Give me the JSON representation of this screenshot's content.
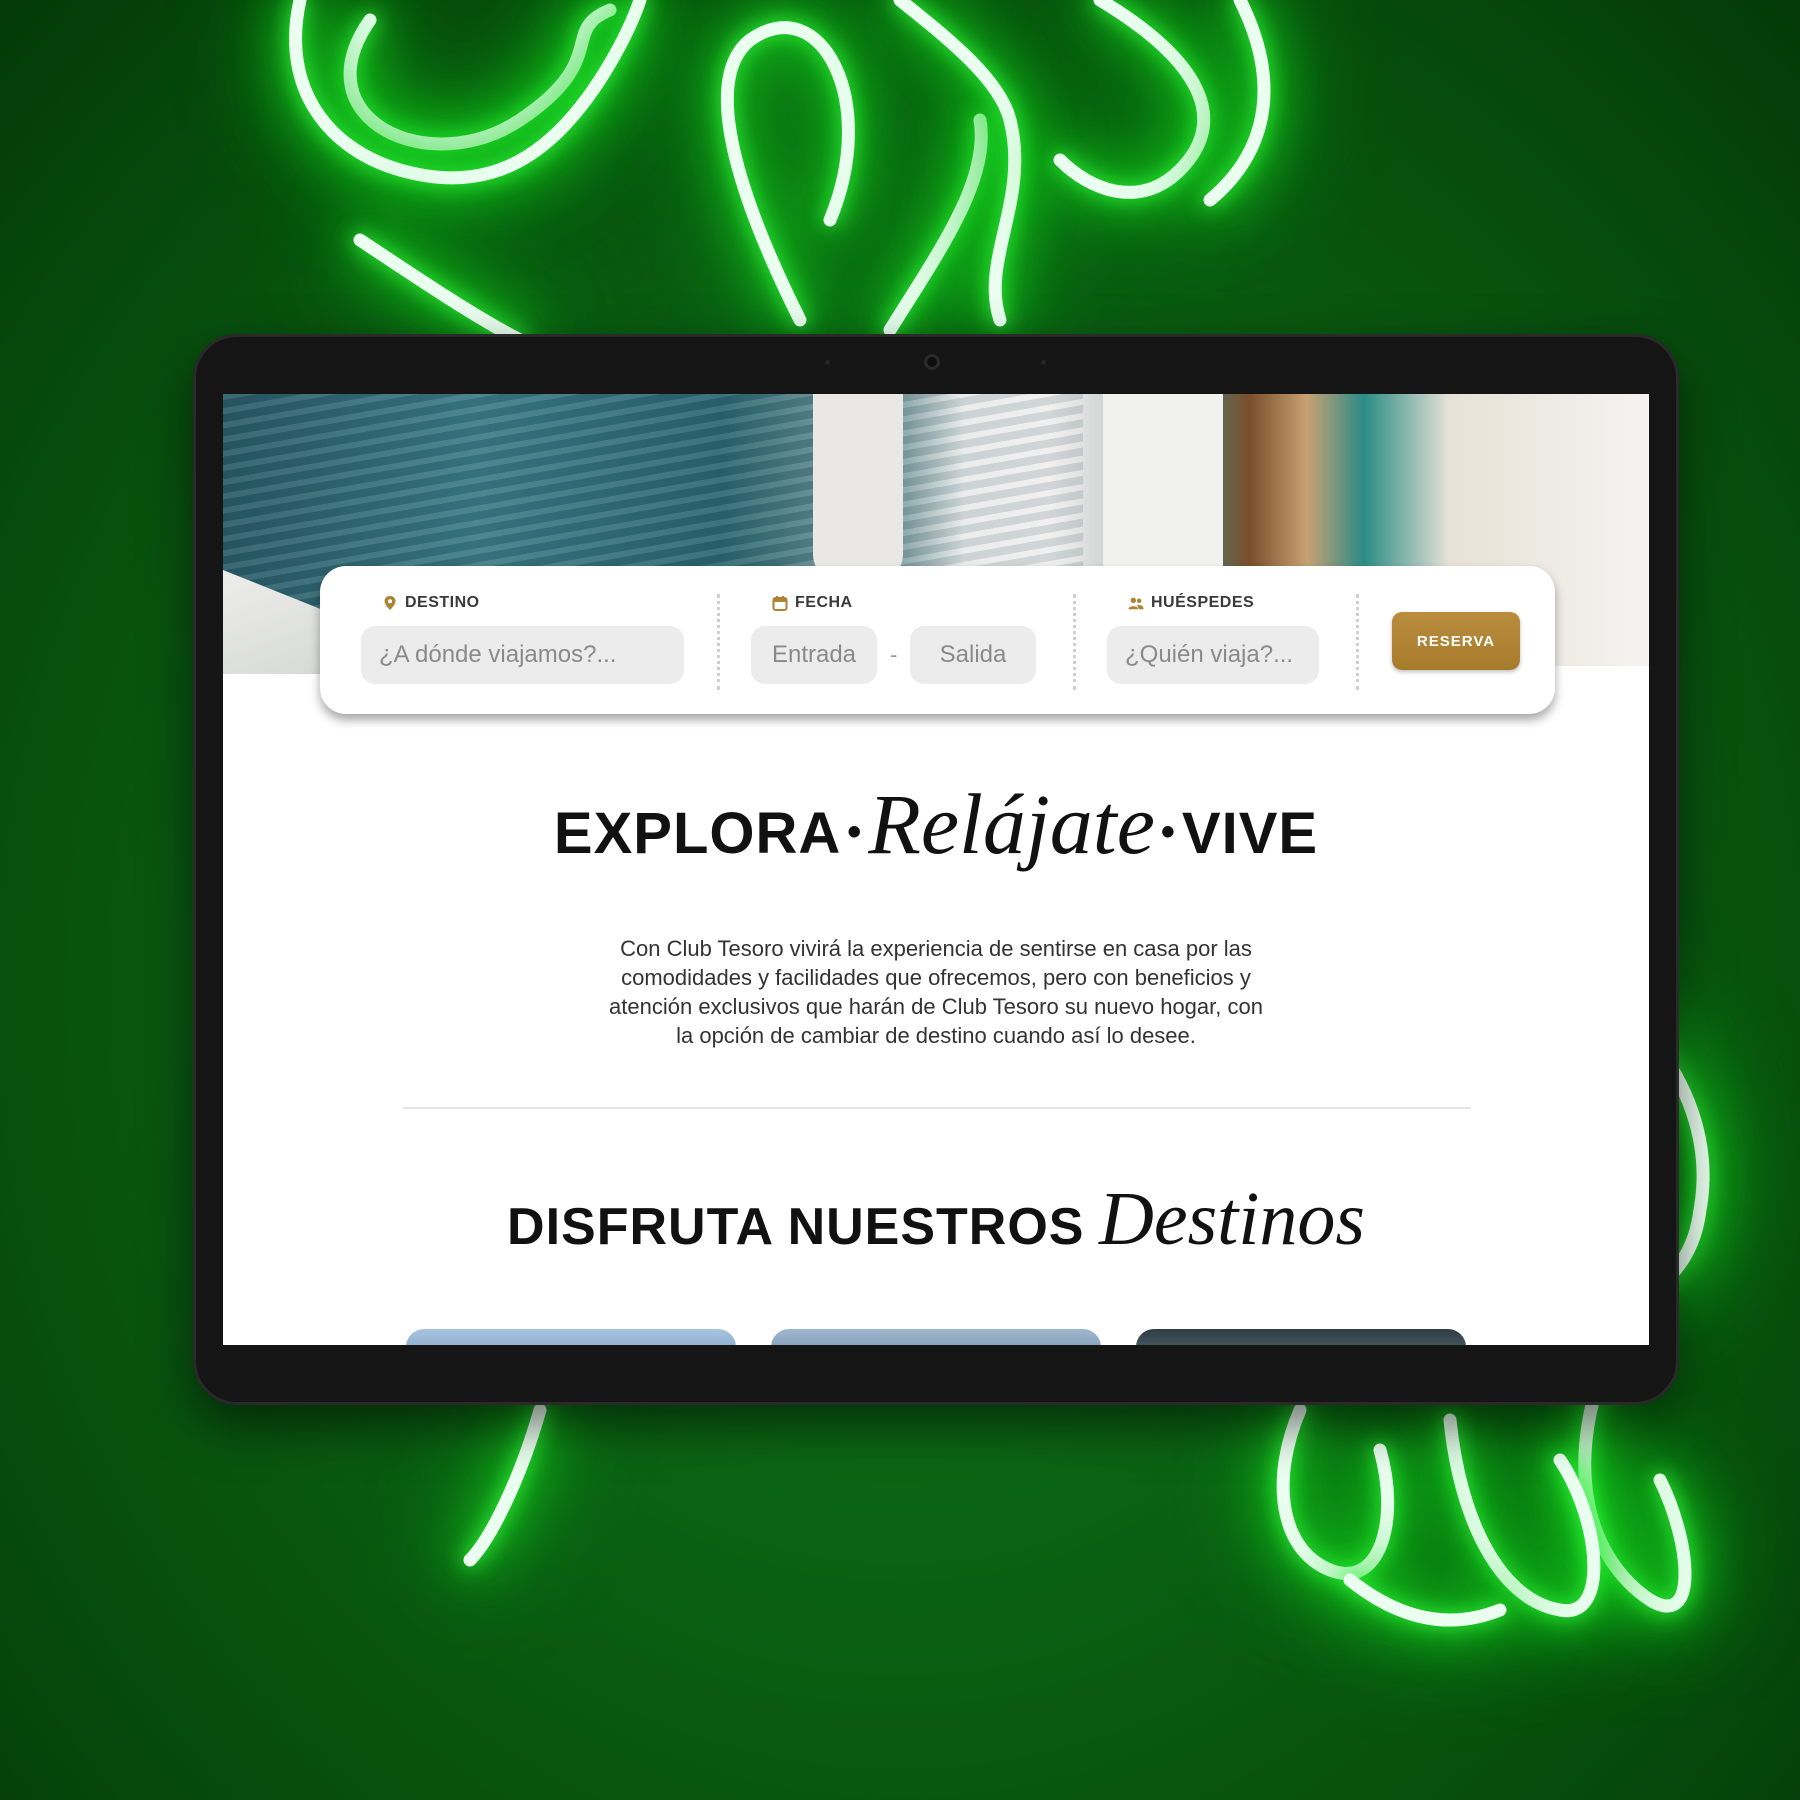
{
  "search": {
    "destination": {
      "label": "DESTINO",
      "placeholder": "¿A dónde viajamos?..."
    },
    "date": {
      "label": "FECHA",
      "checkin_placeholder": "Entrada",
      "checkout_placeholder": "Salida",
      "separator": "-"
    },
    "guests": {
      "label": "HUÉSPEDES",
      "placeholder": "¿Quién viaja?..."
    },
    "reserve_button": "RESERVA"
  },
  "intro": {
    "word1": "EXPLORA",
    "word2": "Relájate",
    "word3": "VIVE",
    "separator": "•",
    "paragraph_lines": [
      "Con Club Tesoro vivirá la experiencia de sentirse en casa por las",
      "comodidades y facilidades que ofrecemos, pero con beneficios y",
      "atención exclusivos que harán de Club Tesoro su nuevo hogar, con",
      "la opción de cambiar de destino cuando así lo desee."
    ]
  },
  "destinations": {
    "title_main": "DISFRUTA NUESTROS",
    "title_script": "Destinos"
  },
  "colors": {
    "accent": "#AD8233",
    "background": "#0A5F12",
    "neon": "#32FF3C"
  },
  "icons": {
    "destination": "location-pin-icon",
    "date": "calendar-icon",
    "guests": "users-icon"
  }
}
